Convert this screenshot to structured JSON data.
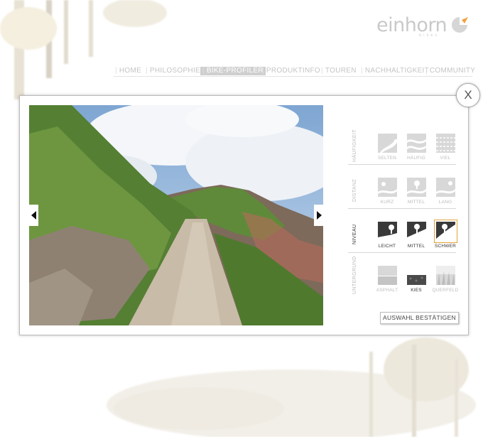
{
  "logo": {
    "text": "einhorn",
    "sub": "bikes"
  },
  "nav": {
    "items": [
      "HOME",
      "PHILOSOPHIE",
      "BIKE-PROFILER",
      "PRODUKTINFO",
      "TOUREN",
      "NACHHALTIGKEIT",
      "COMMUNITY"
    ],
    "active": "BIKE-PROFILER"
  },
  "modal": {
    "close_label": "X"
  },
  "profiler": {
    "groups": [
      {
        "label": "HÄUFIGKEIT",
        "options": [
          "SELTEN",
          "HÄUFIG",
          "VIEL"
        ],
        "selected": null
      },
      {
        "label": "DISTANZ",
        "options": [
          "KURZ",
          "MITTEL",
          "LANG"
        ],
        "selected": null
      },
      {
        "label": "NIVEAU",
        "options": [
          "LEICHT",
          "MITTEL",
          "SCHWER"
        ],
        "selected": "SCHWER"
      },
      {
        "label": "UNTERGRUND",
        "options": [
          "ASPHALT",
          "KIES",
          "QUERFELD"
        ],
        "selected": "KIES"
      }
    ],
    "confirm_label": "AUSWAHL BESTÄTIGEN"
  },
  "colors": {
    "accent": "#e5a23a",
    "sky": "#8fb4d9",
    "grass": "#6a8f3a",
    "rock": "#9c8a78"
  }
}
